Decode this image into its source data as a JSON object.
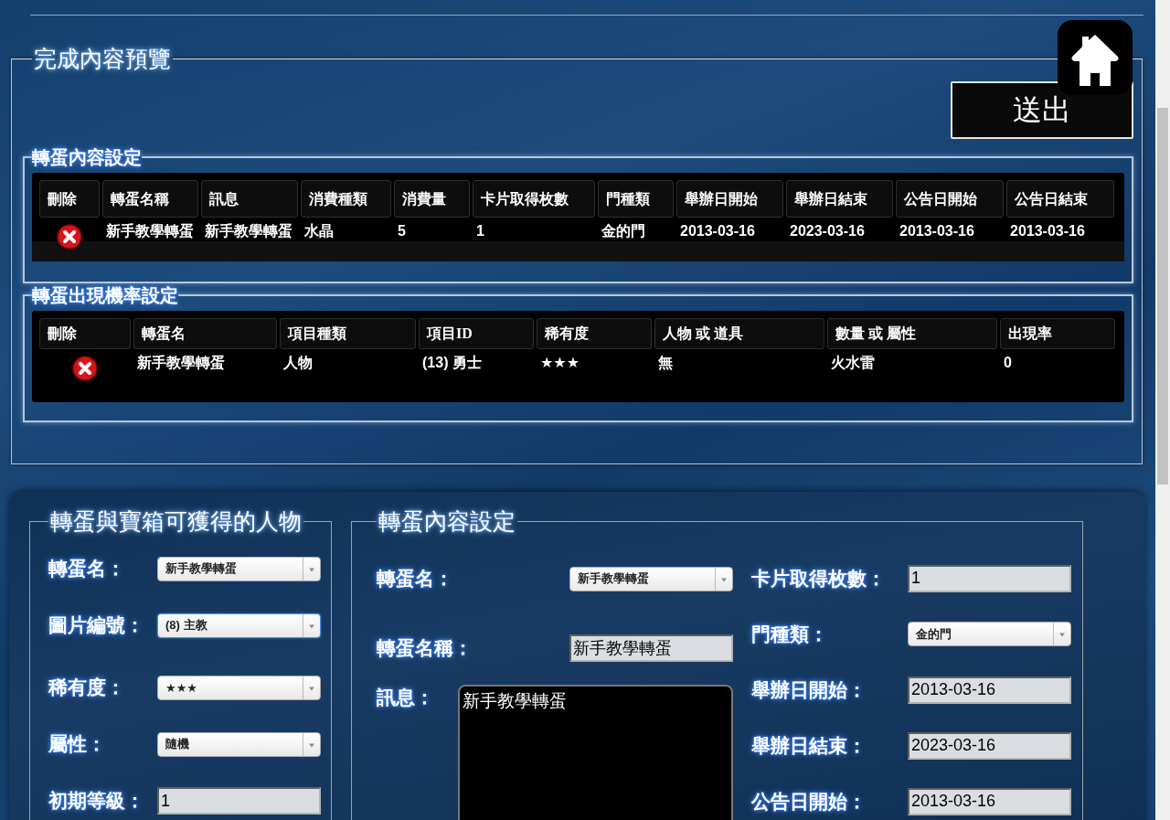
{
  "preview": {
    "title": "完成內容預覽",
    "submit": "送出",
    "content_section": {
      "title": "轉蛋內容設定",
      "columns": [
        "刪除",
        "轉蛋名稱",
        "訊息",
        "消費種類",
        "消費量",
        "卡片取得枚數",
        "門種類",
        "舉辦日開始",
        "舉辦日結束",
        "公告日開始",
        "公告日結束"
      ],
      "rows": [
        {
          "cells": [
            "",
            "新手教學轉蛋",
            "新手教學轉蛋",
            "水晶",
            "5",
            "1",
            "金的門",
            "2013-03-16",
            "2023-03-16",
            "2013-03-16",
            "2013-03-16"
          ]
        }
      ]
    },
    "rate_section": {
      "title": "轉蛋出現機率設定",
      "columns": [
        "刪除",
        "轉蛋名",
        "項目種類",
        "項目ID",
        "稀有度",
        "人物 或 道具",
        "數量 或 屬性",
        "出現率"
      ],
      "rows": [
        {
          "cells": [
            "",
            "新手教學轉蛋",
            "人物",
            "(13) 勇士",
            "★★★",
            "無",
            "火水雷",
            "0"
          ]
        }
      ]
    }
  },
  "character_panel": {
    "title": "轉蛋與寶箱可獲得的人物",
    "fields": [
      {
        "label": "轉蛋名：",
        "kind": "select",
        "value": "新手教學轉蛋",
        "focused": false
      },
      {
        "label": "圖片編號：",
        "kind": "select",
        "value": "(8) 主教",
        "focused": true
      },
      {
        "label": "稀有度：",
        "kind": "select",
        "value": "★★★",
        "focused": false
      },
      {
        "label": "屬性：",
        "kind": "select",
        "value": "隨機",
        "focused": false
      },
      {
        "label": "初期等級：",
        "kind": "input",
        "value": "1"
      }
    ]
  },
  "content_form": {
    "title": "轉蛋內容設定",
    "left_fields": [
      {
        "label": "轉蛋名：",
        "kind": "select",
        "value": "新手教學轉蛋",
        "focused": false
      },
      {
        "label": "轉蛋名稱：",
        "kind": "input",
        "value": "新手教學轉蛋"
      },
      {
        "label": "訊息：",
        "kind": "textarea",
        "value": "新手教學轉蛋"
      }
    ],
    "right_fields": [
      {
        "label": "卡片取得枚數：",
        "kind": "input",
        "value": "1"
      },
      {
        "label": "門種類：",
        "kind": "select",
        "value": "金的門",
        "focused": false
      },
      {
        "label": "舉辦日開始：",
        "kind": "input",
        "value": "2013-03-16"
      },
      {
        "label": "舉辦日結束：",
        "kind": "input",
        "value": "2023-03-16"
      },
      {
        "label": "公告日開始：",
        "kind": "input",
        "value": "2013-03-16"
      }
    ]
  }
}
